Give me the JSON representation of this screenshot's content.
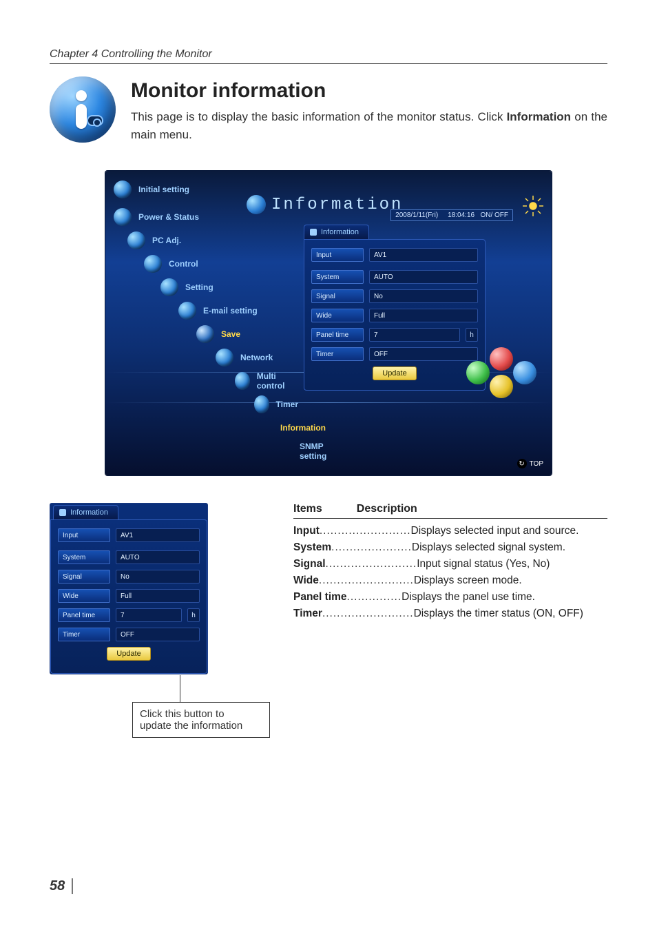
{
  "chapter": "Chapter 4 Controlling the Monitor",
  "title": "Monitor information",
  "intro_prefix": "This page is to display the basic information of the monitor status. Click ",
  "intro_bold": "Information",
  "intro_suffix": " on the main menu.",
  "page_number": "58",
  "panel": {
    "title": "Information",
    "status_date": "2008/1/11(Fri)",
    "status_time": "18:04:16",
    "status_power": "ON/ OFF",
    "top_link": "TOP",
    "nav": {
      "initial": "Initial setting",
      "power": "Power & Status",
      "pcadj": "PC Adj.",
      "control": "Control",
      "setting": "Setting",
      "email": "E-mail setting",
      "save": "Save",
      "network": "Network",
      "multi": "Multi control",
      "timer": "Timer",
      "info": "Information",
      "snmp": "SNMP setting"
    },
    "tab_label": "Information",
    "fields": {
      "input_l": "Input",
      "input_v": "AV1",
      "system_l": "System",
      "system_v": "AUTO",
      "signal_l": "Signal",
      "signal_v": "No",
      "wide_l": "Wide",
      "wide_v": "Full",
      "panel_l": "Panel time",
      "panel_v": "7",
      "panel_u": "h",
      "timer_l": "Timer",
      "timer_v": "OFF"
    },
    "update_btn": "Update"
  },
  "mini": {
    "tab_label": "Information",
    "fields": {
      "input_l": "Input",
      "input_v": "AV1",
      "system_l": "System",
      "system_v": "AUTO",
      "signal_l": "Signal",
      "signal_v": "No",
      "wide_l": "Wide",
      "wide_v": "Full",
      "panel_l": "Panel time",
      "panel_v": "7",
      "panel_u": "h",
      "timer_l": "Timer",
      "timer_v": "OFF"
    },
    "update_btn": "Update"
  },
  "callout_l1": "Click this button to",
  "callout_l2": "update the information",
  "table": {
    "h_items": "Items",
    "h_desc": "Description",
    "rows": [
      {
        "k": "Input",
        "dots": ".........................",
        "v": "Displays selected input and source."
      },
      {
        "k": "System",
        "dots": "......................",
        "v": "Displays selected signal system."
      },
      {
        "k": "Signal",
        "dots": ".........................",
        "v": "Input signal status (Yes, No)"
      },
      {
        "k": "Wide",
        "dots": "..........................",
        "v": "Displays screen mode."
      },
      {
        "k": "Panel time",
        "dots": "...............",
        "v": "Displays the panel use time."
      },
      {
        "k": "Timer",
        "dots": ".........................",
        "v": "Displays the timer status (ON, OFF)"
      }
    ]
  }
}
